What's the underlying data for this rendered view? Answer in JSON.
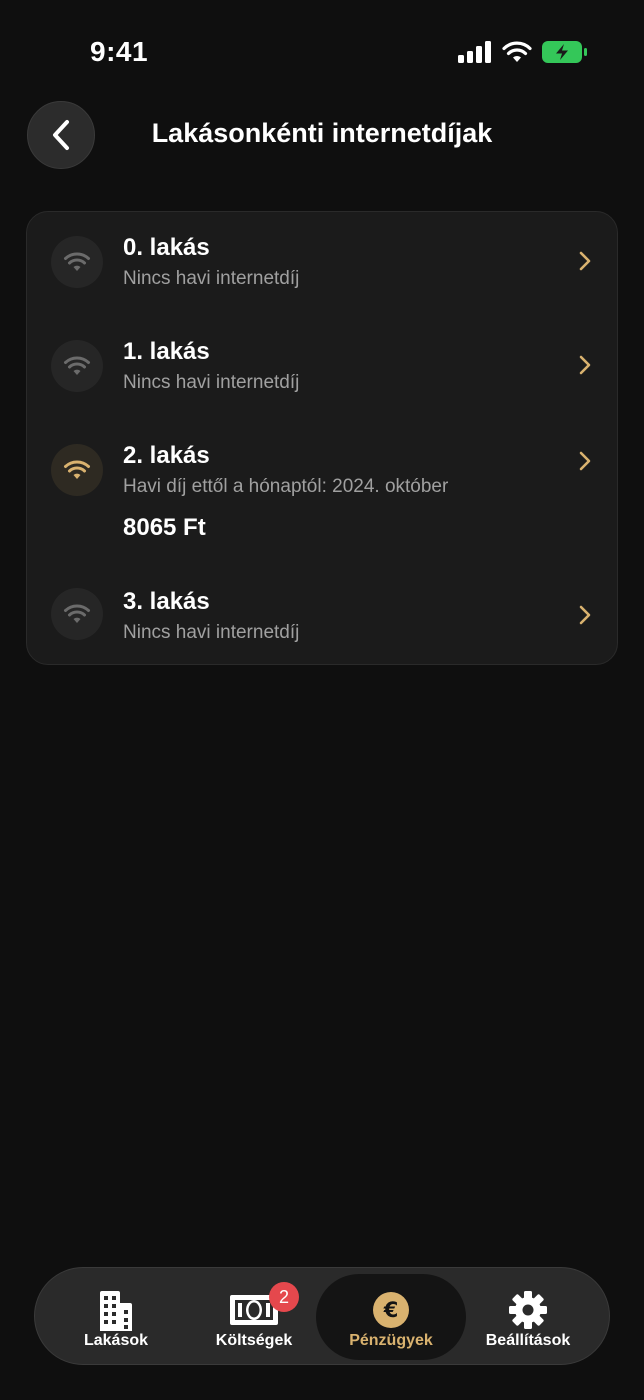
{
  "status_bar": {
    "time": "9:41"
  },
  "header": {
    "title": "Lakásonkénti internetdíjak"
  },
  "apartments": [
    {
      "title": "0. lakás",
      "subtitle": "Nincs havi internetdíj",
      "amount": "",
      "icon": "wifi-icon"
    },
    {
      "title": "1. lakás",
      "subtitle": "Nincs havi internetdíj",
      "amount": "",
      "icon": "wifi-icon"
    },
    {
      "title": "2. lakás",
      "subtitle": "Havi díj ettől a hónaptól: 2024. október",
      "amount": "8065 Ft",
      "icon": "wifi-icon"
    },
    {
      "title": "3. lakás",
      "subtitle": "Nincs havi internetdíj",
      "amount": "",
      "icon": "wifi-icon"
    }
  ],
  "tab_bar": {
    "tabs": [
      {
        "label": "Lakások",
        "icon": "building-icon"
      },
      {
        "label": "Költségek",
        "icon": "banknote-icon",
        "badge": "2"
      },
      {
        "label": "Pénzügyek",
        "icon": "euro-icon"
      },
      {
        "label": "Beállítások",
        "icon": "gear-icon"
      }
    ],
    "active": "Pénzügyek"
  },
  "colors": {
    "accent": "#d9b26f",
    "background": "#0f0f0f",
    "card": "#1b1b1b",
    "badge": "#e5484d",
    "battery": "#34c759"
  }
}
